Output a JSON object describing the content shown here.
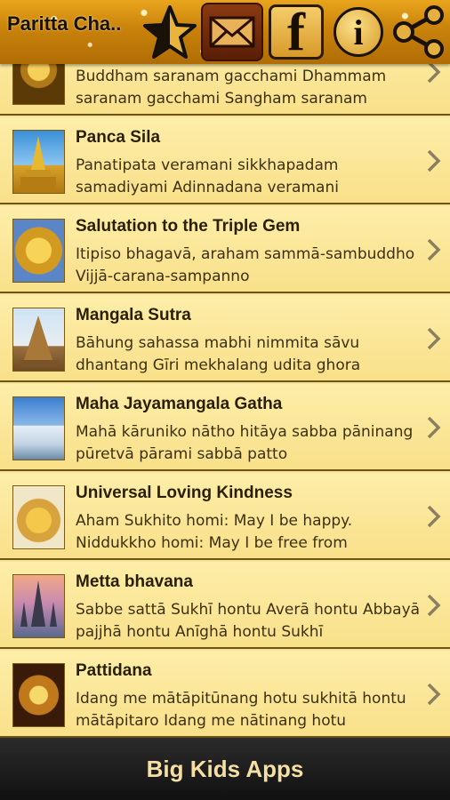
{
  "app_title": "Paritta Cha..",
  "header_icons": [
    "star-icon",
    "mail-icon",
    "facebook-icon",
    "info-icon",
    "share-icon"
  ],
  "items": [
    {
      "title": "",
      "subtitle": "Buddham saranam gacchami Dhammam saranam gacchami Sangham saranam",
      "thumb": "golden-buddha"
    },
    {
      "title": "Panca Sila",
      "subtitle": "Panatipata veramani sikkhapadam samadiyami Adinnadana veramani",
      "thumb": "golden-stupa"
    },
    {
      "title": "Salutation to the Triple Gem",
      "subtitle": "Itipiso bhagavā, araham sammā-sambuddho Vijjā-carana-sampanno",
      "thumb": "golden-statue"
    },
    {
      "title": "Mangala Sutra",
      "subtitle": "Bāhung sahassa mabhi nimmita sāvu dhantang Gīri mekhalang udita ghora",
      "thumb": "pagoda"
    },
    {
      "title": "Maha Jayamangala Gatha",
      "subtitle": "Mahā kāruniko nātho hitāya sabba pāninang pūretvā pārami sabbā patto",
      "thumb": "white-temple"
    },
    {
      "title": "Universal Loving Kindness",
      "subtitle": "Aham Sukhito homi: May I be happy. Niddukkho homi: May I be free from",
      "thumb": "golden-buddha-shrine"
    },
    {
      "title": "Metta bhavana",
      "subtitle": "Sabbe sattā Sukhī hontu Averā hontu Abbayā pajjhā hontu Anīghā hontu Sukhī",
      "thumb": "wat-arun"
    },
    {
      "title": "Pattidana",
      "subtitle": "Idang me mātāpitūnang hotu sukhitā hontu mātāpitaro Idang me nātinang hotu",
      "thumb": "temple-interior"
    }
  ],
  "footer_label": "Big Kids Apps",
  "colors": {
    "row_bg": "#f9e08a",
    "divider": "#6e5516",
    "footer_bg": "#1a1a1a",
    "footer_text": "#f5dfa2"
  }
}
